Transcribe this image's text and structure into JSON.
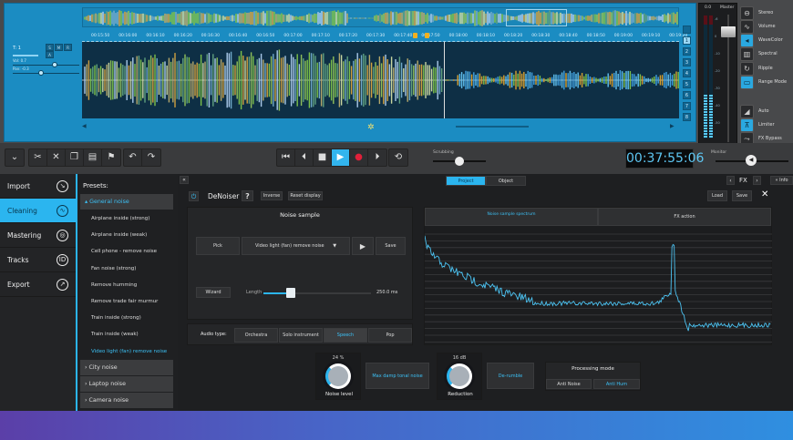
{
  "track": {
    "name": "T: 1",
    "buttons": [
      "S",
      "M",
      "R",
      "A"
    ],
    "vol": "Vol: 0.7",
    "pan": "Pan: -0.3",
    "vol_level": 0.6,
    "pan_level": 0.4
  },
  "ruler": {
    "ticks": [
      "00:15:50",
      "00:16:00",
      "00:16:10",
      "00:16:20",
      "00:16:30",
      "00:16:40",
      "00:16:50",
      "00:17:00",
      "00:17:10",
      "00:17:20",
      "00:17:30",
      "00:17:40",
      "00:17:50",
      "00:18:00",
      "00:18:10",
      "00:18:20",
      "00:18:30",
      "00:18:40",
      "00:18:50",
      "00:19:00",
      "00:19:10",
      "00:19:20"
    ]
  },
  "track_numbers": [
    "1",
    "2",
    "3",
    "4",
    "5",
    "6",
    "7",
    "8"
  ],
  "mixer": {
    "peak": "0.0",
    "label": "Master",
    "scale": [
      "-6",
      "0",
      "-10",
      "-20",
      "-30",
      "-40",
      "-50"
    ]
  },
  "view_buttons": [
    {
      "label": "Stereo",
      "icon": "stereo-icon",
      "active": false
    },
    {
      "label": "Volume",
      "icon": "volume-icon",
      "active": false
    },
    {
      "label": "WaveColor",
      "icon": "wavecolor-icon",
      "active": true
    },
    {
      "label": "Spectral",
      "icon": "spectral-icon",
      "active": false
    },
    {
      "label": "Ripple",
      "icon": "ripple-icon",
      "active": false
    },
    {
      "label": "Range Mode",
      "icon": "range-mode-icon",
      "active": true
    },
    {
      "label": "Auto",
      "icon": "auto-icon",
      "active": false
    },
    {
      "label": "Limiter",
      "icon": "limiter-icon",
      "active": true
    },
    {
      "label": "FX Bypass",
      "icon": "fx-bypass-icon",
      "active": false
    }
  ],
  "transport": {
    "scrubbing_label": "Scrubbing",
    "monitor_label": "Monitor",
    "time": "00:37:55:06"
  },
  "nav": [
    {
      "label": "Import",
      "icon": "import-icon",
      "active": false
    },
    {
      "label": "Cleaning",
      "icon": "cleaning-icon",
      "active": true
    },
    {
      "label": "Mastering",
      "icon": "mastering-icon",
      "active": false
    },
    {
      "label": "Tracks",
      "icon": "tracks-icon",
      "active": false
    },
    {
      "label": "Export",
      "icon": "export-icon",
      "active": false
    }
  ],
  "presets": {
    "title": "Presets:",
    "group_open": "General noise",
    "items": [
      "Airplane inside (strong)",
      "Airplane inside (weak)",
      "Cell phone - remove noise",
      "Fan noise (strong)",
      "Remove humming",
      "Remove trade fair murmur",
      "Train inside (strong)",
      "Train inside (weak)",
      "Video light (fan) remove noise"
    ],
    "selected": "Video light (fan) remove noise",
    "groups": [
      "City noise",
      "Laptop noise",
      "Camera noise"
    ]
  },
  "tabs": {
    "project": "Project",
    "object": "Object",
    "fx": "FX",
    "info": "Info"
  },
  "denoiser": {
    "title": "DeNoiser",
    "help": "?",
    "inverse": "Inverse",
    "reset": "Reset display",
    "load": "Load",
    "save": "Save",
    "noise_sample": "Noise sample",
    "pick": "Pick",
    "preset": "Video light (fan) remove noise",
    "save_sample": "Save",
    "wizard": "Wizard",
    "length_label": "Length",
    "length_value": "250.0 ms",
    "length_level": 0.3,
    "audio_type_label": "Audio type:",
    "audio_types": [
      "Orchestra",
      "Solo instrument",
      "Speech",
      "Pop"
    ],
    "audio_selected": "Speech",
    "spectrum_tab": "Noise sample spectrum",
    "fx_tab": "FX action",
    "noise_level_value": "24 %",
    "noise_level_label": "Noise level",
    "max_damp": "Max damp tonal noise",
    "reduction_value": "16 dB",
    "reduction_label": "Reduction",
    "derumble": "De-rumble",
    "processing_mode": "Processing mode",
    "anti_noise": "Anti Noise",
    "anti_hum": "Anti Hum"
  },
  "colors": {
    "accent": "#2bb5ef",
    "panel_blue": "#1b8cc2",
    "record": "#e0203a"
  }
}
